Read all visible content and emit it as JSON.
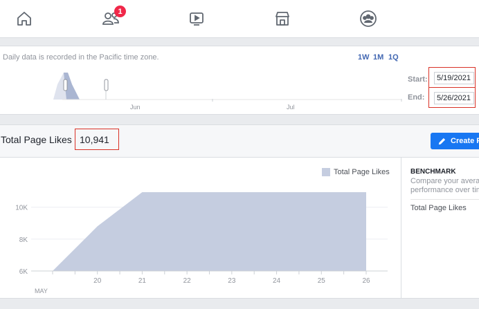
{
  "nav": {
    "items": [
      {
        "name": "home-icon"
      },
      {
        "name": "people-icon",
        "badge": "1"
      },
      {
        "name": "watch-icon"
      },
      {
        "name": "marketplace-icon"
      },
      {
        "name": "groups-icon"
      }
    ]
  },
  "range": {
    "timezone_note": "Daily data is recorded in the Pacific time zone.",
    "periods": [
      "1W",
      "1M",
      "1Q"
    ],
    "mini_months": [
      "Jun",
      "Jul"
    ],
    "start_label": "Start:",
    "start_value": "5/19/2021",
    "end_label": "End:",
    "end_value": "5/26/2021"
  },
  "likes": {
    "title": "Total Page Likes",
    "value": "10,941",
    "create_label": "Create P"
  },
  "benchmark": {
    "title": "BENCHMARK",
    "desc_line1": "Compare your avera",
    "desc_line2": "performance over tim",
    "metric": "Total Page Likes"
  },
  "chart_data": {
    "type": "area",
    "legend": [
      "Total Page Likes"
    ],
    "color": "#c5cde0",
    "x_month_label": "MAY",
    "x": [
      "19",
      "20",
      "21",
      "22",
      "23",
      "24",
      "25",
      "26"
    ],
    "x_tick_labels": [
      "20",
      "21",
      "22",
      "23",
      "24",
      "25",
      "26"
    ],
    "y_tick_labels": [
      "6K",
      "8K",
      "10K"
    ],
    "y_ticks": [
      6000,
      8000,
      10000
    ],
    "ylim": [
      6000,
      11200
    ],
    "series": [
      {
        "name": "Total Page Likes",
        "values": [
          6000,
          8800,
          10941,
          10941,
          10941,
          10941,
          10941,
          10941
        ]
      }
    ]
  }
}
